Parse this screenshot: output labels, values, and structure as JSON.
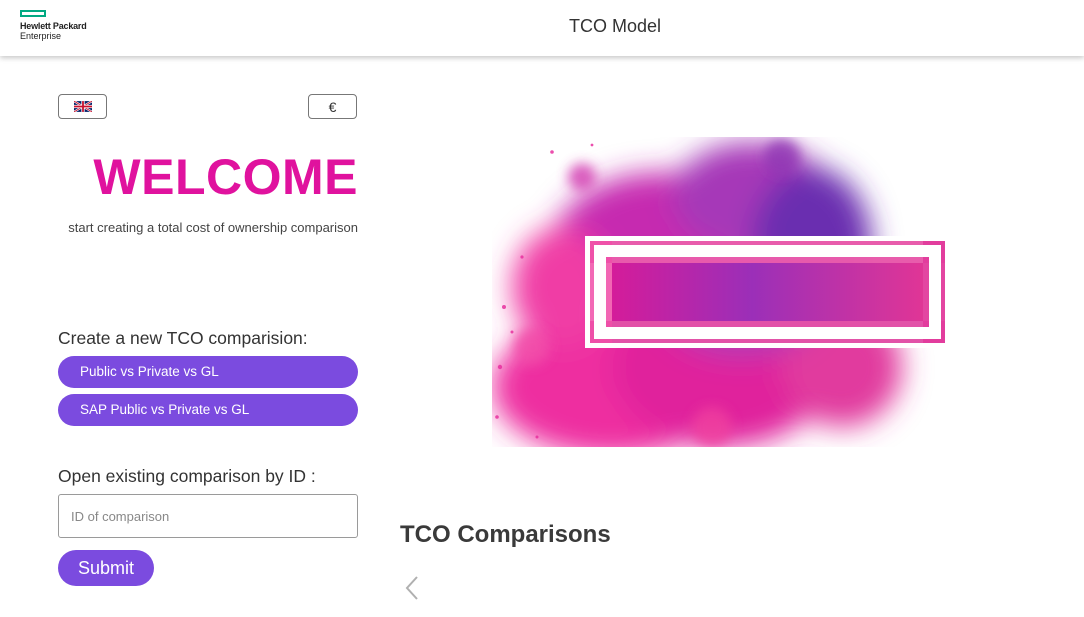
{
  "header": {
    "logo_line1": "Hewlett Packard",
    "logo_line2": "Enterprise",
    "title": "TCO Model"
  },
  "selectors": {
    "language_icon": "uk-flag-icon",
    "currency": "€"
  },
  "welcome": {
    "heading": "WELCOME",
    "subtitle": "start creating a total cost of ownership comparison"
  },
  "create": {
    "label": "Create a new TCO comparision:",
    "options": [
      {
        "label": "Public vs Private vs GL"
      },
      {
        "label": "SAP Public vs Private vs GL"
      }
    ]
  },
  "open": {
    "label": "Open existing comparison by ID :",
    "placeholder": "ID of comparison",
    "value": "",
    "submit_label": "Submit"
  },
  "comparisons": {
    "title": "TCO Comparisons",
    "prev_icon": "chevron-left-icon"
  },
  "colors": {
    "accent_purple": "#7b4bdf",
    "welcome_magenta": "#e0129e",
    "hpe_green": "#01a982"
  }
}
